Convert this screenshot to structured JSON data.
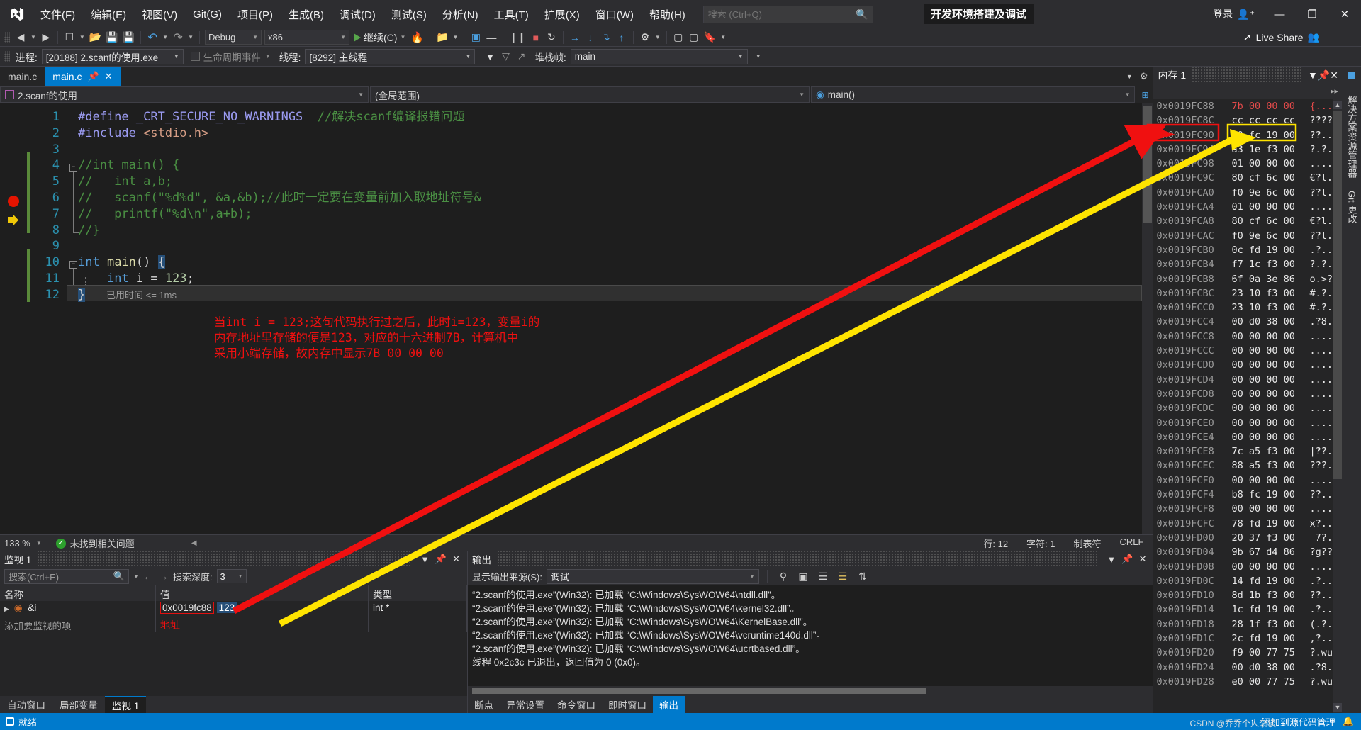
{
  "window": {
    "title": "开发环境搭建及调试",
    "signin_label": "登录",
    "minimize": "—",
    "restore": "❐",
    "close": "✕"
  },
  "menu": {
    "items": [
      "文件(F)",
      "编辑(E)",
      "视图(V)",
      "Git(G)",
      "项目(P)",
      "生成(B)",
      "调试(D)",
      "测试(S)",
      "分析(N)",
      "工具(T)",
      "扩展(X)",
      "窗口(W)",
      "帮助(H)"
    ]
  },
  "search": {
    "placeholder": "搜索 (Ctrl+Q)",
    "value": ""
  },
  "toolbar": {
    "config": "Debug",
    "platform": "x86",
    "run_label": "继续(C)",
    "live_share": "Live Share"
  },
  "debugbar": {
    "process_label": "进程:",
    "process_value": "[20188] 2.scanf的使用.exe",
    "lifecycle_label": "生命周期事件",
    "thread_label": "线程:",
    "thread_value": "[8292] 主线程",
    "stackframe_label": "堆栈帧:",
    "stackframe_value": "main"
  },
  "tabs": {
    "inactive": "main.c",
    "active": "main.c"
  },
  "navbar": {
    "project": "2.scanf的使用",
    "scope": "(全局范围)",
    "member": "main()"
  },
  "editor": {
    "lines": [
      {
        "n": "1",
        "tokens": [
          {
            "t": "#define ",
            "c": "pp"
          },
          {
            "t": "_CRT_SECURE_NO_WARNINGS",
            "c": "pp"
          },
          {
            "t": "  ",
            "c": "pl"
          },
          {
            "t": "//解决scanf编译报错问题",
            "c": "cmt"
          }
        ]
      },
      {
        "n": "2",
        "tokens": [
          {
            "t": "#include ",
            "c": "pp"
          },
          {
            "t": "<stdio.h>",
            "c": "str"
          }
        ]
      },
      {
        "n": "3",
        "tokens": []
      },
      {
        "n": "4",
        "tokens": [
          {
            "t": "//int main() {",
            "c": "cmt"
          }
        ]
      },
      {
        "n": "5",
        "tokens": [
          {
            "t": "//   int a,b;",
            "c": "cmt"
          }
        ]
      },
      {
        "n": "6",
        "tokens": [
          {
            "t": "//   scanf(\"%d%d\", &a,&b);//此时一定要在变量前加入取地址符号&",
            "c": "cmt"
          }
        ]
      },
      {
        "n": "7",
        "tokens": [
          {
            "t": "//   printf(\"%d\\n\",a+b);",
            "c": "cmt"
          }
        ]
      },
      {
        "n": "8",
        "tokens": [
          {
            "t": "//}",
            "c": "cmt"
          }
        ]
      },
      {
        "n": "9",
        "tokens": []
      },
      {
        "n": "10",
        "tokens": [
          {
            "t": "int",
            "c": "kw"
          },
          {
            "t": " ",
            "c": "pl"
          },
          {
            "t": "main",
            "c": "fn"
          },
          {
            "t": "() ",
            "c": "pl"
          },
          {
            "t": "{",
            "c": "sel-brace"
          }
        ]
      },
      {
        "n": "11",
        "tokens": [
          {
            "t": "    ",
            "c": "pl"
          },
          {
            "t": "int",
            "c": "kw"
          },
          {
            "t": " i = ",
            "c": "pl"
          },
          {
            "t": "123",
            "c": "num"
          },
          {
            "t": ";",
            "c": "pl"
          }
        ]
      },
      {
        "n": "12",
        "tokens": [
          {
            "t": "}",
            "c": "sel-brace"
          }
        ]
      }
    ],
    "elapsed": "已用时间 <= 1ms",
    "annotation": [
      "当int i = 123;这句代码执行过之后，此时i=123，变量i的",
      "内存地址里存储的便是123，对应的十六进制7B，计算机中",
      "采用小端存储，故内存中显示7B 00 00 00"
    ]
  },
  "editor_status": {
    "zoom": "133 %",
    "issues": "未找到相关问题",
    "line": "行: 12",
    "char": "字符: 1",
    "tabs": "制表符",
    "eol": "CRLF"
  },
  "watch": {
    "title": "监视 1",
    "search_placeholder": "搜索(Ctrl+E)",
    "depth_label": "搜索深度:",
    "depth_value": "3",
    "columns": [
      "名称",
      "值",
      "类型"
    ],
    "rows": [
      {
        "name": "&i",
        "value": "0x0019fc88",
        "value_extra": "123",
        "type": "int *"
      }
    ],
    "add_row": "添加要监视的项",
    "address_label": "地址",
    "tabs": [
      "自动窗口",
      "局部变量",
      "监视 1"
    ],
    "active_tab": "监视 1"
  },
  "output": {
    "title": "输出",
    "source_label": "显示输出来源(S):",
    "source_value": "调试",
    "lines": [
      "“2.scanf的使用.exe”(Win32): 已加载 “C:\\Windows\\SysWOW64\\ntdll.dll”。",
      "“2.scanf的使用.exe”(Win32): 已加载 “C:\\Windows\\SysWOW64\\kernel32.dll”。",
      "“2.scanf的使用.exe”(Win32): 已加载 “C:\\Windows\\SysWOW64\\KernelBase.dll”。",
      "“2.scanf的使用.exe”(Win32): 已加载 “C:\\Windows\\SysWOW64\\vcruntime140d.dll”。",
      "“2.scanf的使用.exe”(Win32): 已加载 “C:\\Windows\\SysWOW64\\ucrtbased.dll”。",
      "线程 0x2c3c 已退出，返回值为 0 (0x0)。"
    ],
    "tabs": [
      "断点",
      "异常设置",
      "命令窗口",
      "即时窗口",
      "输出"
    ],
    "active_tab": "输出"
  },
  "memory": {
    "title": "内存 1",
    "rows": [
      {
        "addr": "0x0019FC88",
        "hex": "7b 00 00 00",
        "chars": "{...",
        "highlight": true
      },
      {
        "addr": "0x0019FC8C",
        "hex": "cc cc cc cc",
        "chars": "????",
        "highlight": false
      },
      {
        "addr": "0x0019FC90",
        "hex": "b0 fc 19 00",
        "chars": "??..",
        "highlight": false
      },
      {
        "addr": "0x0019FC94",
        "hex": "a3 1e f3 00",
        "chars": "?.?.",
        "highlight": false
      },
      {
        "addr": "0x0019FC98",
        "hex": "01 00 00 00",
        "chars": "....",
        "highlight": false
      },
      {
        "addr": "0x0019FC9C",
        "hex": "80 cf 6c 00",
        "chars": "€?l.",
        "highlight": false
      },
      {
        "addr": "0x0019FCA0",
        "hex": "f0 9e 6c 00",
        "chars": "??l.",
        "highlight": false
      },
      {
        "addr": "0x0019FCA4",
        "hex": "01 00 00 00",
        "chars": "....",
        "highlight": false
      },
      {
        "addr": "0x0019FCA8",
        "hex": "80 cf 6c 00",
        "chars": "€?l.",
        "highlight": false
      },
      {
        "addr": "0x0019FCAC",
        "hex": "f0 9e 6c 00",
        "chars": "??l.",
        "highlight": false
      },
      {
        "addr": "0x0019FCB0",
        "hex": "0c fd 19 00",
        "chars": ".?..",
        "highlight": false
      },
      {
        "addr": "0x0019FCB4",
        "hex": "f7 1c f3 00",
        "chars": "?.?.",
        "highlight": false
      },
      {
        "addr": "0x0019FCB8",
        "hex": "6f 0a 3e 86",
        "chars": "o.>?",
        "highlight": false
      },
      {
        "addr": "0x0019FCBC",
        "hex": "23 10 f3 00",
        "chars": "#.?.",
        "highlight": false
      },
      {
        "addr": "0x0019FCC0",
        "hex": "23 10 f3 00",
        "chars": "#.?.",
        "highlight": false
      },
      {
        "addr": "0x0019FCC4",
        "hex": "00 d0 38 00",
        "chars": ".?8.",
        "highlight": false
      },
      {
        "addr": "0x0019FCC8",
        "hex": "00 00 00 00",
        "chars": "....",
        "highlight": false
      },
      {
        "addr": "0x0019FCCC",
        "hex": "00 00 00 00",
        "chars": "....",
        "highlight": false
      },
      {
        "addr": "0x0019FCD0",
        "hex": "00 00 00 00",
        "chars": "....",
        "highlight": false
      },
      {
        "addr": "0x0019FCD4",
        "hex": "00 00 00 00",
        "chars": "....",
        "highlight": false
      },
      {
        "addr": "0x0019FCD8",
        "hex": "00 00 00 00",
        "chars": "....",
        "highlight": false
      },
      {
        "addr": "0x0019FCDC",
        "hex": "00 00 00 00",
        "chars": "....",
        "highlight": false
      },
      {
        "addr": "0x0019FCE0",
        "hex": "00 00 00 00",
        "chars": "....",
        "highlight": false
      },
      {
        "addr": "0x0019FCE4",
        "hex": "00 00 00 00",
        "chars": "....",
        "highlight": false
      },
      {
        "addr": "0x0019FCE8",
        "hex": "7c a5 f3 00",
        "chars": "|??.",
        "highlight": false
      },
      {
        "addr": "0x0019FCEC",
        "hex": "88 a5 f3 00",
        "chars": "???.",
        "highlight": false
      },
      {
        "addr": "0x0019FCF0",
        "hex": "00 00 00 00",
        "chars": "....",
        "highlight": false
      },
      {
        "addr": "0x0019FCF4",
        "hex": "b8 fc 19 00",
        "chars": "??..",
        "highlight": false
      },
      {
        "addr": "0x0019FCF8",
        "hex": "00 00 00 00",
        "chars": "....",
        "highlight": false
      },
      {
        "addr": "0x0019FCFC",
        "hex": "78 fd 19 00",
        "chars": "x?..",
        "highlight": false
      },
      {
        "addr": "0x0019FD00",
        "hex": "20 37 f3 00",
        "chars": " 7?.",
        "highlight": false
      },
      {
        "addr": "0x0019FD04",
        "hex": "9b 67 d4 86",
        "chars": "?g??",
        "highlight": false
      },
      {
        "addr": "0x0019FD08",
        "hex": "00 00 00 00",
        "chars": "....",
        "highlight": false
      },
      {
        "addr": "0x0019FD0C",
        "hex": "14 fd 19 00",
        "chars": ".?..",
        "highlight": false
      },
      {
        "addr": "0x0019FD10",
        "hex": "8d 1b f3 00",
        "chars": "??..",
        "highlight": false
      },
      {
        "addr": "0x0019FD14",
        "hex": "1c fd 19 00",
        "chars": ".?..",
        "highlight": false
      },
      {
        "addr": "0x0019FD18",
        "hex": "28 1f f3 00",
        "chars": "(.?.",
        "highlight": false
      },
      {
        "addr": "0x0019FD1C",
        "hex": "2c fd 19 00",
        "chars": ",?..",
        "highlight": false
      },
      {
        "addr": "0x0019FD20",
        "hex": "f9 00 77 75",
        "chars": "?.wu",
        "highlight": false
      },
      {
        "addr": "0x0019FD24",
        "hex": "00 d0 38 00",
        "chars": ".?8.",
        "highlight": false
      },
      {
        "addr": "0x0019FD28",
        "hex": "e0 00 77 75",
        "chars": "?.wu",
        "highlight": false
      }
    ]
  },
  "vtabs": [
    "解决方案资源管理器",
    "Git 更改"
  ],
  "statusbar": {
    "ready": "就绪",
    "source_control": "添加到源代码管理",
    "watermark": "CSDN @乔乔个人杂谈"
  },
  "colors": {
    "accent": "#007acc",
    "annotation_red": "#f01010",
    "arrow_yellow": "#ffe400",
    "breakpoint": "#e51400"
  }
}
